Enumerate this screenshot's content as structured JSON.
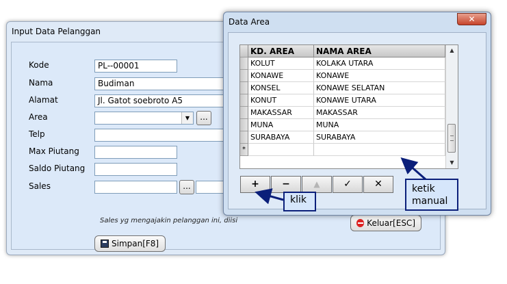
{
  "customer_window": {
    "title": "Input Data Pelanggan",
    "labels": {
      "kode": "Kode",
      "nama": "Nama",
      "alamat": "Alamat",
      "area": "Area",
      "telp": "Telp",
      "max_piutang": "Max Piutang",
      "saldo_piutang": "Saldo Piutang",
      "sales": "Sales"
    },
    "values": {
      "kode": "PL--00001",
      "nama": "Budiman",
      "alamat": "Jl. Gatot soebroto A5",
      "area": "",
      "telp": "",
      "max_piutang": "",
      "saldo_piutang": "",
      "sales": ""
    },
    "browse_label": "...",
    "sales_hint": "Sales yg mengajakin pelanggan ini, diisi",
    "save_label": "Simpan[F8]",
    "exit_label": "Keluar[ESC]"
  },
  "area_window": {
    "title": "Data Area",
    "close_label": "✕",
    "columns": [
      "KD. AREA",
      "NAMA AREA"
    ],
    "rows": [
      {
        "kd": "KOLUT",
        "nama": "KOLAKA UTARA"
      },
      {
        "kd": "KONAWE",
        "nama": "KONAWE"
      },
      {
        "kd": "KONSEL",
        "nama": "KONAWE SELATAN"
      },
      {
        "kd": "KONUT",
        "nama": "KONAWE UTARA"
      },
      {
        "kd": "MAKASSAR",
        "nama": "MAKASSAR"
      },
      {
        "kd": "MUNA",
        "nama": "MUNA"
      },
      {
        "kd": "SURABAYA",
        "nama": "SURABAYA"
      }
    ],
    "new_row_marker": "*",
    "nav_buttons": {
      "insert": "+",
      "delete": "−",
      "edit": "▲",
      "post": "✓",
      "cancel": "✕"
    }
  },
  "annotations": {
    "click": "klik",
    "manual": "ketik manual"
  }
}
